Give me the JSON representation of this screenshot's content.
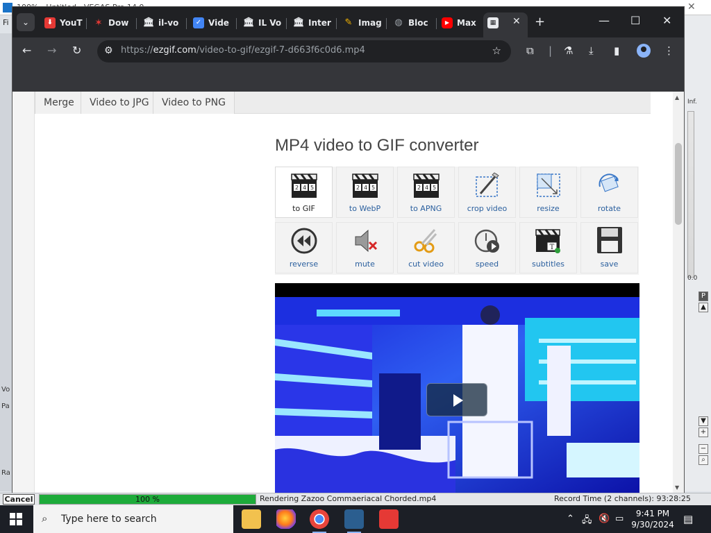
{
  "background_app": {
    "title": "100% - Untitled - VEGAS Pro 14.0",
    "menu_first": "Fi",
    "left_labels": [
      "Vo",
      "Pa",
      "Ra"
    ],
    "right_labels": [
      "Inf.",
      "0.0",
      "P"
    ]
  },
  "browser": {
    "tabs": [
      {
        "label": "YouT",
        "icon": "download-icon",
        "color": "#e53935"
      },
      {
        "label": "Dow",
        "icon": "star-icon",
        "color": "#e53935"
      },
      {
        "label": "il-vo",
        "icon": "columns-icon",
        "color": "#e8eaed"
      },
      {
        "label": "Vide",
        "icon": "shield-check-icon",
        "color": "#4285f4"
      },
      {
        "label": "IL Vo",
        "icon": "columns-icon",
        "color": "#e8eaed"
      },
      {
        "label": "Inter",
        "icon": "columns-icon",
        "color": "#e8eaed"
      },
      {
        "label": "Imag",
        "icon": "brush-icon",
        "color": "#f4b400"
      },
      {
        "label": "Bloc",
        "icon": "globe-icon",
        "color": "#9aa0a6"
      },
      {
        "label": "Max",
        "icon": "youtube-icon",
        "color": "#ff0000"
      }
    ],
    "url_host": "ezgif.com",
    "url_prefix": "https://",
    "url_path": "/video-to-gif/ezgif-7-d663f6c0d6.mp4"
  },
  "page": {
    "sub_nav": [
      "Merge",
      "Video to JPG",
      "Video to PNG"
    ],
    "title": "MP4 video to GIF converter",
    "tools": [
      {
        "label": "to GIF",
        "icon": "clapperboard-icon",
        "active": true
      },
      {
        "label": "to WebP",
        "icon": "clapperboard-icon"
      },
      {
        "label": "to APNG",
        "icon": "clapperboard-icon"
      },
      {
        "label": "crop video",
        "icon": "crop-icon"
      },
      {
        "label": "resize",
        "icon": "resize-icon"
      },
      {
        "label": "rotate",
        "icon": "rotate-icon"
      },
      {
        "label": "reverse",
        "icon": "rewind-icon"
      },
      {
        "label": "mute",
        "icon": "mute-icon"
      },
      {
        "label": "cut video",
        "icon": "scissors-icon"
      },
      {
        "label": "speed",
        "icon": "stopwatch-icon"
      },
      {
        "label": "subtitles",
        "icon": "subtitles-icon"
      },
      {
        "label": "save",
        "icon": "floppy-disk-icon"
      }
    ]
  },
  "render_bar": {
    "cancel_label": "Cancel",
    "progress_percent": 100,
    "progress_label": "100 %",
    "status_text": "Rendering Zazoo Commaeriacal Chorded.mp4",
    "record_time": "Record Time (2 channels): 93:28:25"
  },
  "taskbar": {
    "search_placeholder": "Type here to search",
    "time": "9:41 PM",
    "date": "9/30/2024"
  }
}
